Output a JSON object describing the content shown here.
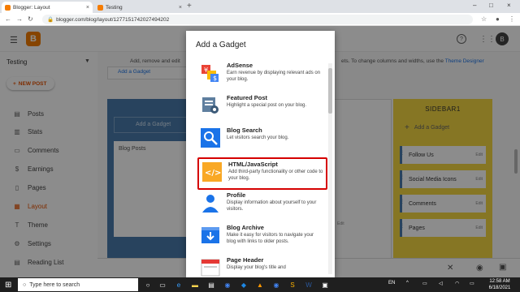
{
  "browser": {
    "tabs": [
      {
        "title": "Blogger: Layout",
        "close": "×"
      },
      {
        "title": "Testing",
        "close": "×"
      }
    ],
    "new_tab": "+",
    "window_controls": [
      "–",
      "□",
      "×"
    ],
    "url": "blogger.com/blog/layout/127715174202749420​2",
    "nav": [
      "←",
      "→",
      "↻"
    ]
  },
  "header": {
    "logo": "B",
    "avatar_letter": "B"
  },
  "sidebar": {
    "blog_name": "Testing",
    "new_post": "NEW POST",
    "items": [
      {
        "label": "Posts",
        "icon": "posts-icon",
        "glyph": "▤"
      },
      {
        "label": "Stats",
        "icon": "stats-icon",
        "glyph": "▥"
      },
      {
        "label": "Comments",
        "icon": "comments-icon",
        "glyph": "▭"
      },
      {
        "label": "Earnings",
        "icon": "earnings-icon",
        "glyph": "$"
      },
      {
        "label": "Pages",
        "icon": "pages-icon",
        "glyph": "▯"
      },
      {
        "label": "Layout",
        "icon": "layout-icon",
        "glyph": "▦"
      },
      {
        "label": "Theme",
        "icon": "theme-icon",
        "glyph": "T"
      },
      {
        "label": "Settings",
        "icon": "settings-icon",
        "glyph": "⚙"
      },
      {
        "label": "Reading List",
        "icon": "reading-list-icon",
        "glyph": "▤"
      }
    ]
  },
  "main": {
    "intro_left": "Add, remove and edit",
    "intro_right": "ets. To change columns and widths, use the",
    "theme_designer": "Theme Designer",
    "add_gadget_top": "Add a Gadget",
    "blog_posts": "Blog Posts",
    "edit": "Edit",
    "sidebar_title": "SIDEBAR1",
    "add_gadget": "Add a Gadget",
    "gadgets": [
      "Follow Us",
      "Social Media Icons",
      "Comments",
      "Pages"
    ]
  },
  "modal": {
    "title": "Add a Gadget",
    "items": [
      {
        "name": "AdSense",
        "desc": "Earn revenue by displaying relevant ads on your blog.",
        "icon": "adsense-icon"
      },
      {
        "name": "Featured Post",
        "desc": "Highlight a special post on your blog.",
        "icon": "featured-post-icon"
      },
      {
        "name": "Blog Search",
        "desc": "Let visitors search your blog.",
        "icon": "blog-search-icon"
      },
      {
        "name": "HTML/JavaScript",
        "desc": "Add third-party functionality or other code to your blog.",
        "icon": "html-javascript-icon"
      },
      {
        "name": "Profile",
        "desc": "Display information about yourself to your visitors.",
        "icon": "profile-icon"
      },
      {
        "name": "Blog Archive",
        "desc": "Make it easy for visitors to navigate your blog with links to older posts.",
        "icon": "blog-archive-icon"
      },
      {
        "name": "Page Header",
        "desc": "Display your blog's title and",
        "icon": "page-header-icon"
      }
    ]
  },
  "taskbar": {
    "search_placeholder": "Type here to search",
    "lang": "EN",
    "time": "12:58 AM",
    "date": "6/18/2021"
  },
  "colors": {
    "accent": "#f57c00",
    "blue_panel": "#4a7bab",
    "yellow_panel": "#f5d742",
    "highlight": "#d50000"
  }
}
